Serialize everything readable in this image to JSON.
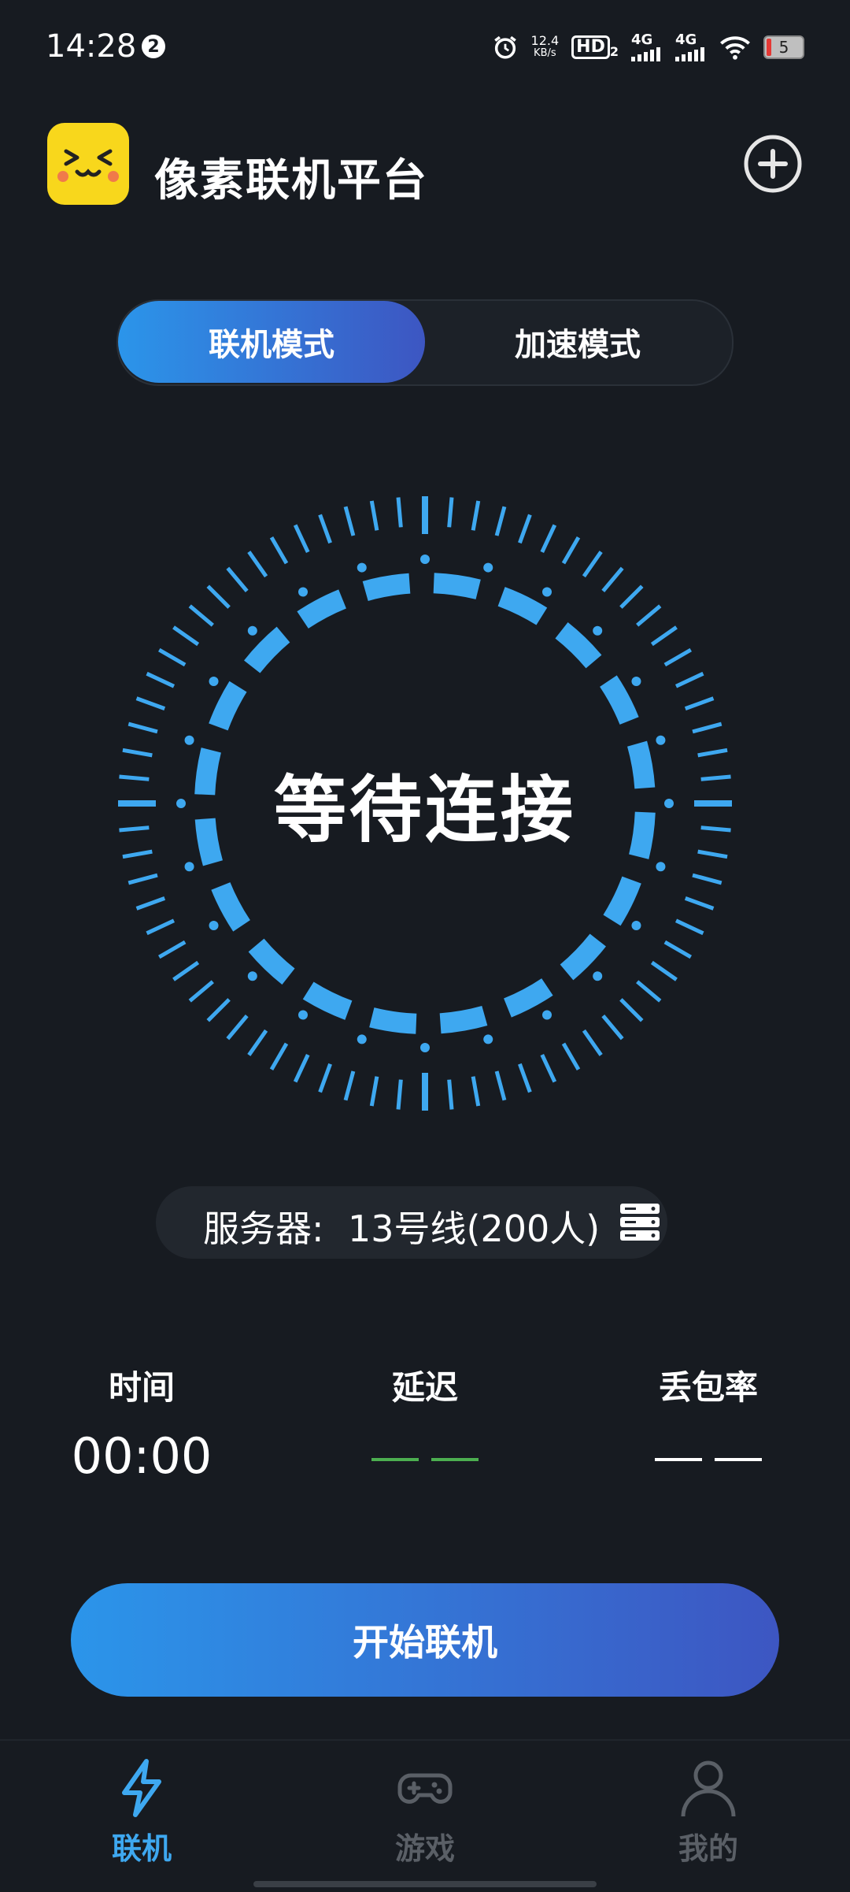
{
  "status_bar": {
    "time": "14:28",
    "notification_count": "2",
    "net_speed_value": "12.4",
    "net_speed_unit": "KB/s",
    "hd": "HD",
    "hd_sub": "2",
    "signal1": "4G",
    "signal2": "4G",
    "battery": "5"
  },
  "header": {
    "title": "像素联机平台"
  },
  "mode_toggle": {
    "active_label": "联机模式",
    "inactive_label": "加速模式"
  },
  "dial": {
    "status_text": "等待连接",
    "accent_color": "#3ea8f0"
  },
  "server": {
    "label": "服务器:",
    "value": "13号线(200人)"
  },
  "stats": {
    "time_label": "时间",
    "time_value": "00:00",
    "latency_label": "延迟",
    "loss_label": "丢包率"
  },
  "start_button": {
    "label": "开始联机"
  },
  "bottom_nav": {
    "items": [
      {
        "label": "联机",
        "active": true
      },
      {
        "label": "游戏",
        "active": false
      },
      {
        "label": "我的",
        "active": false
      }
    ],
    "active_color": "#3ea8f0",
    "inactive_color": "#5a5f66"
  }
}
